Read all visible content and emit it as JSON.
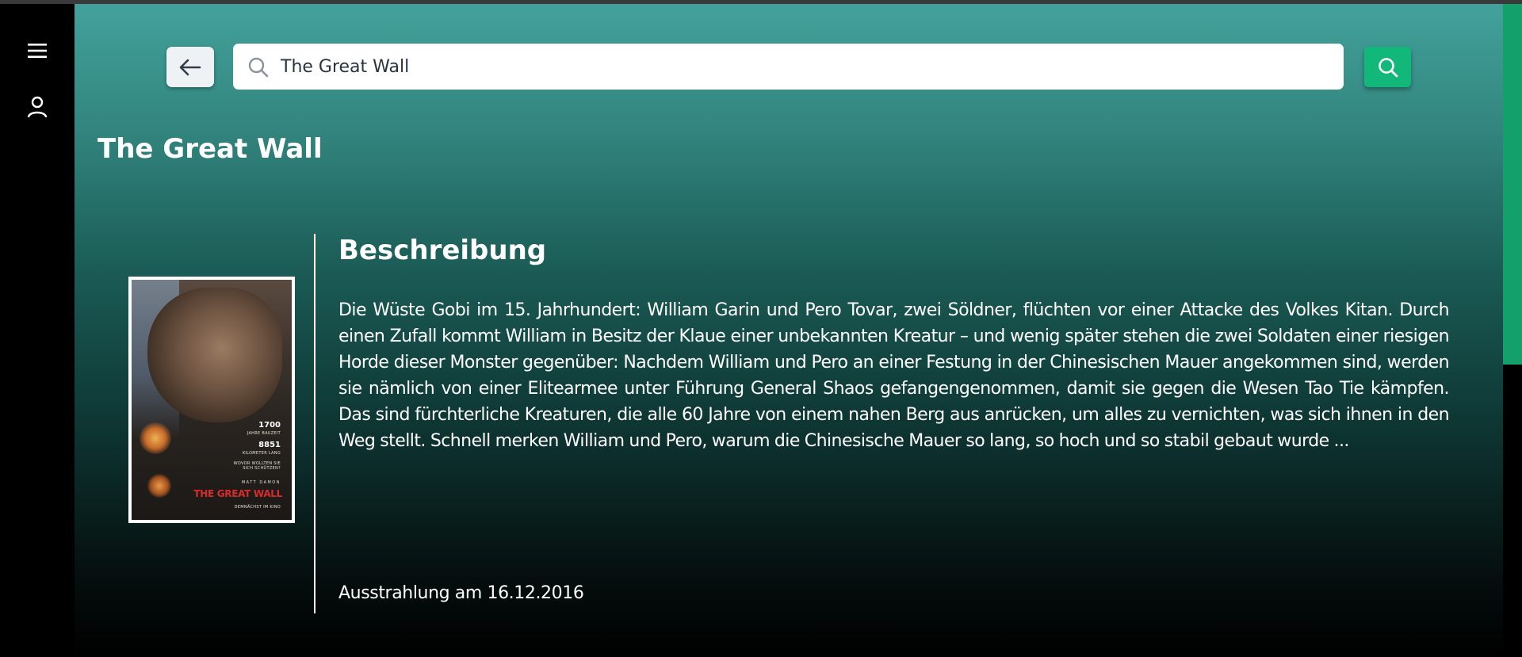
{
  "search": {
    "query": "The Great Wall",
    "placeholder": ""
  },
  "page": {
    "title": "The Great Wall"
  },
  "detail": {
    "heading": "Beschreibung",
    "description": "Die Wüste Gobi im 15. Jahrhundert: William Garin und Pero Tovar, zwei Söldner, flüchten vor einer Attacke des Volkes Kitan. Durch einen Zufall kommt William in Besitz der Klaue einer unbekannten Kreatur – und wenig später stehen die zwei Soldaten einer riesigen Horde dieser Monster gegenüber: Nachdem William und Pero an einer Festung in der Chinesischen Mauer angekommen sind, werden sie nämlich von einer Elitearmee unter Führung General Shaos gefangengenommen, damit sie gegen die Wesen Tao Tie kämpfen. Das sind fürchterliche Kreaturen, die alle 60 Jahre von einem nahen Berg aus anrücken, um alles zu vernichten, was sich ihnen in den Weg stellt. Schnell merken William und Pero, warum die Chinesische Mauer so lang, so hoch und so stabil gebaut wurde ...",
    "airdate": "Ausstrahlung am 16.12.2016"
  },
  "poster": {
    "stat1_number": "1700",
    "stat1_label": "JAHRE BAUZEIT",
    "stat2_number": "8851",
    "stat2_label": "KILOMETER LANG",
    "tagline": "WOVOR WOLLTEN SIE SICH SCHÜTZEN?",
    "actor": "MATT DAMON",
    "title": "THE GREAT WALL",
    "footer": "DEMNÄCHST IM KINO"
  },
  "icons": {
    "menu": "hamburger-menu-icon",
    "user": "user-icon",
    "back": "arrow-left-icon",
    "search": "search-icon"
  },
  "colors": {
    "accent": "#12b77a",
    "scrollbar": "#13a06b",
    "gradient_top": "#43a19b",
    "background": "#000000"
  }
}
